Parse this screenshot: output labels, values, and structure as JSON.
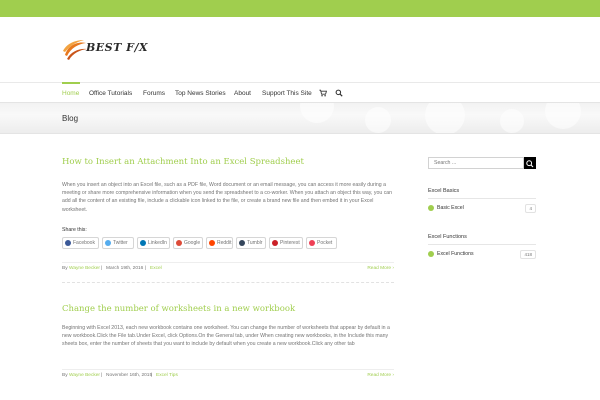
{
  "brand": {
    "logo_text": "BEST F/X",
    "accent_color": "#a0ce4e",
    "logo_icon": "swoosh-logo-icon"
  },
  "nav": {
    "items": [
      {
        "label": "Home",
        "active": true
      },
      {
        "label": "Office Tutorials"
      },
      {
        "label": "Forums"
      },
      {
        "label": "Top News Stories"
      },
      {
        "label": "About"
      },
      {
        "label": "Support This Site"
      }
    ],
    "cart_icon": "cart-icon",
    "search_icon": "search-icon"
  },
  "page": {
    "title": "Blog"
  },
  "posts": [
    {
      "title": "How to Insert an Attachment Into an Excel Spreadsheet",
      "excerpt": "When you insert an object into an Excel file, such as a PDF file, Word document or an email message, you can access it more easily during a meeting or share more comprehensive information when you send the spreadsheet to a co-worker. When you attach an object this way, you can add all the content of an existing file, include a clickable icon linked to the file, or create a brand new file and then embed it in your Excel worksheet.",
      "share_label": "Share this:",
      "share_buttons": [
        "Facebook",
        "Twitter",
        "LinkedIn",
        "Google",
        "Reddit",
        "Tumblr",
        "Pinterest",
        "Pocket"
      ],
      "meta": {
        "by": "By",
        "author": "Wayne Becker",
        "date": "March 19th, 2016",
        "category": "Excel",
        "sep": "|"
      },
      "read_more": "Read More ›"
    },
    {
      "title": "Change the number of worksheets in a new workbook",
      "excerpt": "Beginning with Excel 2013, each new workbook contains one worksheet. You can change the number of worksheets that appear by default in a new workbook.Click the File tab.Under Excel, click Options.On the General tab, under When creating new workbooks, in the Include this many sheets box, enter the number of sheets that you want to include by default when you create a new workbook.Click any other tab",
      "meta": {
        "by": "By",
        "author": "Wayne Becker",
        "date": "November 16th, 2015",
        "category": "Excel Tips",
        "sep": "|"
      },
      "read_more": "Read More ›"
    }
  ],
  "sidebar": {
    "search_placeholder": "Search ...",
    "widgets": [
      {
        "title": "Excel Basics",
        "items": [
          {
            "label": "Basic Excel",
            "count": "4"
          }
        ]
      },
      {
        "title": "Excel Functions",
        "items": [
          {
            "label": "Excel Functions",
            "count": "418"
          }
        ]
      }
    ]
  },
  "share_colors": {
    "Facebook": "#3b5998",
    "Twitter": "#55acee",
    "LinkedIn": "#0077b5",
    "Google": "#dd4b39",
    "Reddit": "#ff4500",
    "Tumblr": "#35465c",
    "Pinterest": "#cb2027",
    "Pocket": "#ef4056"
  }
}
